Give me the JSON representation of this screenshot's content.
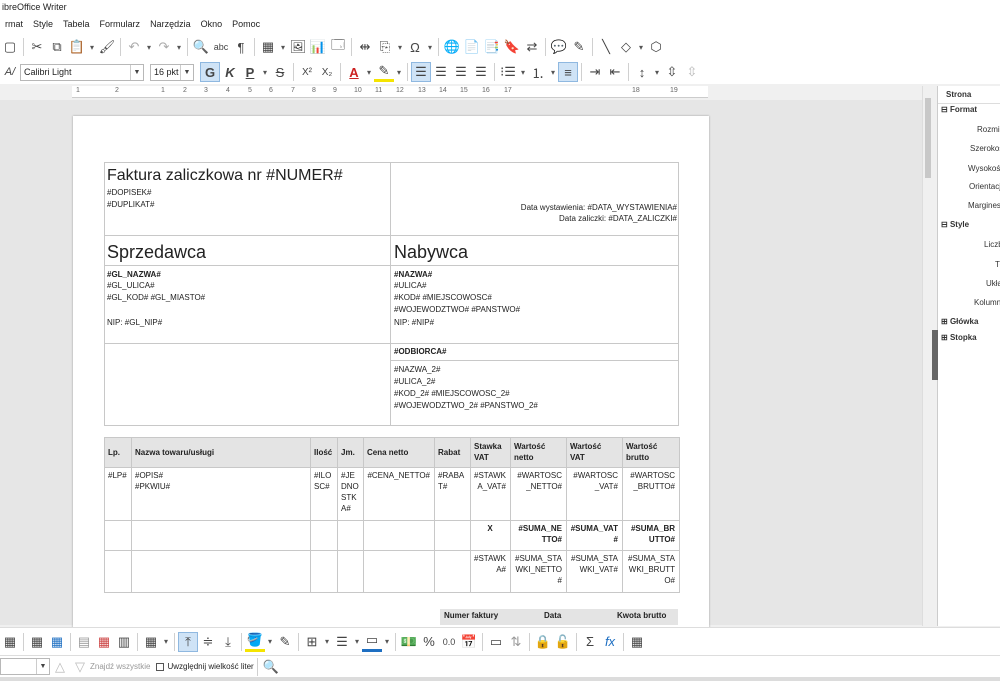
{
  "window": {
    "title": "ibreOffice Writer"
  },
  "menu": [
    "rmat",
    "Style",
    "Tabela",
    "Formularz",
    "Narzędzia",
    "Okno",
    "Pomoc"
  ],
  "formatting": {
    "font_name": "Calibri Light",
    "font_size": "16 pkt"
  },
  "ruler": {
    "ticks": [
      "1",
      "2",
      "1",
      "2",
      "3",
      "4",
      "5",
      "6",
      "7",
      "8",
      "9",
      "10",
      "11",
      "12",
      "13",
      "14",
      "15",
      "16",
      "17",
      "18",
      "19"
    ]
  },
  "document": {
    "title": "Faktura zaliczkowa nr #NUMER#",
    "dopisek": "#DOPISEK#",
    "duplikat": "#DUPLIKAT#",
    "data_wystawienia": "Data wystawienia: #DATA_WYSTAWIENIA#",
    "data_zaliczki": "Data zaliczki: #DATA_ZALICZKI#",
    "seller_heading": "Sprzedawca",
    "buyer_heading": "Nabywca",
    "seller_lines": [
      "#GL_NAZWA#",
      "#GL_ULICA#",
      "#GL_KOD# #GL_MIASTO#",
      "",
      "NIP: #GL_NIP#"
    ],
    "buyer_lines": [
      "#NAZWA#",
      "#ULICA#",
      "#KOD# #MIEJSCOWOSC#",
      "#WOJEWODZTWO# #PANSTWO#",
      "NIP: #NIP#"
    ],
    "recipient_heading": "#ODBIORCA#",
    "recipient_lines": [
      "#NAZWA_2#",
      "#ULICA_2#",
      "#KOD_2# #MIEJSCOWOSC_2#",
      "#WOJEWODZTWO_2# #PANSTWO_2#"
    ]
  },
  "items_table": {
    "headers": [
      "Lp.",
      "Nazwa towaru/usługi",
      "Ilość",
      "Jm.",
      "Cena netto",
      "Rabat",
      "Stawka VAT",
      "Wartość netto",
      "Wartość VAT",
      "Wartość brutto"
    ],
    "row": [
      "#LP#",
      "#OPIS#\n#PKWIU#",
      "#ILOSC#",
      "#JEDNOSTKA#",
      "#CENA_NETTO#",
      "#RABAT#",
      "#STAWKA_VAT#",
      "#WARTOSC_NETTO#",
      "#WARTOSC_VAT#",
      "#WARTOSC_BRUTTO#"
    ],
    "sum_row": [
      "X",
      "#SUMA_NETTO#",
      "#SUMA_VAT#",
      "#SUMA_BRUTTO#"
    ],
    "rates_row": [
      "#STAWKA#",
      "#SUMA_STAWKI_NETTO#",
      "#SUMA_STAWKI_VAT#",
      "#SUMA_STAWKI_BRUTTO#"
    ]
  },
  "bottom_table": {
    "headers": [
      "Numer faktury",
      "Data",
      "Kwota brutto"
    ]
  },
  "sidebar": {
    "title": "Strona",
    "format_section": "Format",
    "format_fields": [
      "Rozmia",
      "Szerokoś",
      "Wysokoś",
      "Orientacj",
      "Margines"
    ],
    "style_section": "Style",
    "style_fields": [
      "Liczb",
      "Tł",
      "Ukła",
      "Kolumn"
    ],
    "header_section": "Główka",
    "footer_section": "Stopka"
  },
  "findbar": {
    "find_all": "Znajdź wszystkie",
    "match_case": "Uwzględnij wielkość liter"
  },
  "colors": {
    "accent": "#1e6fc2",
    "font_color": "#cc2222",
    "highlight": "#f5e400"
  }
}
